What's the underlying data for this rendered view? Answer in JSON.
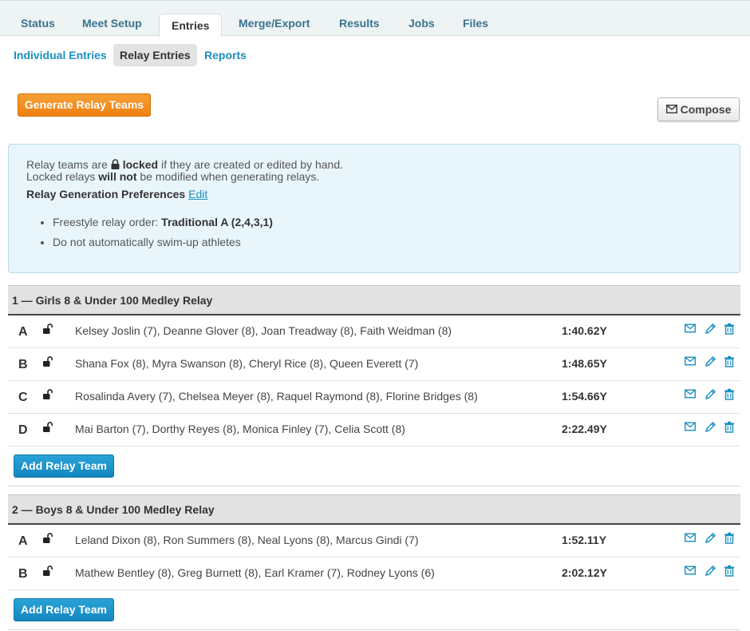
{
  "top_tabs": [
    {
      "label": "Status"
    },
    {
      "label": "Meet Setup"
    },
    {
      "label": "Entries",
      "active": true
    },
    {
      "label": "Merge/Export"
    },
    {
      "label": "Results"
    },
    {
      "label": "Jobs"
    },
    {
      "label": "Files"
    }
  ],
  "sub_tabs": [
    {
      "label": "Individual Entries"
    },
    {
      "label": "Relay Entries",
      "active": true
    },
    {
      "label": "Reports"
    }
  ],
  "actions": {
    "generate_label": "Generate Relay Teams",
    "compose_label": "Compose"
  },
  "info": {
    "line1_pre": "Relay teams are",
    "line1_bold": "locked",
    "line1_post": "if they are created or edited by hand.",
    "line2_pre": "Locked relays",
    "line2_bold": "will not",
    "line2_post": "be modified when generating relays.",
    "prefs_label": "Relay Generation Preferences",
    "edit_label": "Edit",
    "pref1_pre": "Freestyle relay order:",
    "pref1_bold": "Traditional A (2,4,3,1)",
    "pref2": "Do not automatically swim-up athletes"
  },
  "events": [
    {
      "title": "1 — Girls 8 & Under 100 Medley Relay",
      "teams": [
        {
          "letter": "A",
          "names": "Kelsey Joslin (7), Deanne Glover (8), Joan Treadway (8), Faith Weidman (8)",
          "time": "1:40.62Y"
        },
        {
          "letter": "B",
          "names": "Shana Fox (8), Myra Swanson (8), Cheryl Rice (8), Queen Everett (7)",
          "time": "1:48.65Y"
        },
        {
          "letter": "C",
          "names": "Rosalinda Avery (7), Chelsea Meyer (8), Raquel Raymond (8), Florine Bridges (8)",
          "time": "1:54.66Y"
        },
        {
          "letter": "D",
          "names": "Mai Barton (7), Dorthy Reyes (8), Monica Finley (7), Celia Scott (8)",
          "time": "2:22.49Y"
        }
      ],
      "add_label": "Add Relay Team"
    },
    {
      "title": "2 — Boys 8 & Under 100 Medley Relay",
      "teams": [
        {
          "letter": "A",
          "names": "Leland Dixon (8), Ron Summers (8), Neal Lyons (8), Marcus Gindi (7)",
          "time": "1:52.11Y"
        },
        {
          "letter": "B",
          "names": "Mathew Bentley (8), Greg Burnett (8), Earl Kramer (7), Rodney Lyons (6)",
          "time": "2:02.12Y"
        }
      ],
      "add_label": "Add Relay Team"
    }
  ],
  "colors": {
    "link": "#1b8fc0",
    "orange": "#ef7f10",
    "blue_button": "#1387bf",
    "info_bg": "#e8f6fc"
  },
  "icons": {
    "lock": "unlocked-padlock-icon",
    "email": "envelope-icon",
    "edit": "pencil-icon",
    "delete": "trash-icon"
  }
}
